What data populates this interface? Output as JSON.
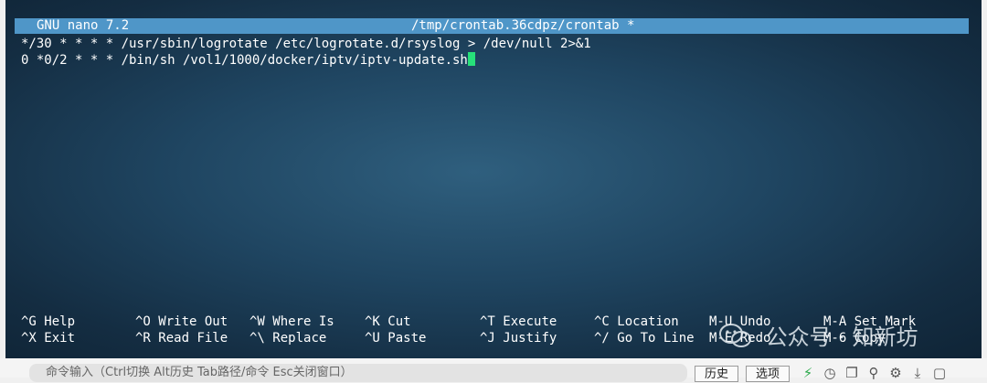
{
  "titlebar": {
    "app": "GNU nano 7.2",
    "file": "/tmp/crontab.36cdpz/crontab *"
  },
  "editor": {
    "lines": [
      "*/30 * * * * /usr/sbin/logrotate /etc/logrotate.d/rsyslog > /dev/null 2>&1",
      "0 *0/2 * * * /bin/sh /vol1/1000/docker/iptv/iptv-update.sh"
    ]
  },
  "shortcuts": [
    {
      "key": "^G",
      "label": "Help"
    },
    {
      "key": "^X",
      "label": "Exit"
    },
    {
      "key": "^O",
      "label": "Write Out"
    },
    {
      "key": "^R",
      "label": "Read File"
    },
    {
      "key": "^W",
      "label": "Where Is"
    },
    {
      "key": "^\\",
      "label": "Replace"
    },
    {
      "key": "^K",
      "label": "Cut"
    },
    {
      "key": "^U",
      "label": "Paste"
    },
    {
      "key": "^T",
      "label": "Execute"
    },
    {
      "key": "^J",
      "label": "Justify"
    },
    {
      "key": "^C",
      "label": "Location"
    },
    {
      "key": "^/",
      "label": "Go To Line"
    },
    {
      "key": "M-U",
      "label": "Undo"
    },
    {
      "key": "M-E",
      "label": "Redo"
    },
    {
      "key": "M-A",
      "label": "Set Mark"
    },
    {
      "key": "M-6",
      "label": "Copy"
    }
  ],
  "watermark": {
    "text": "公众号 · 知新坊",
    "icon": "wechat-icon"
  },
  "bottombar": {
    "command_placeholder": "命令输入（Ctrl切换 Alt历史 Tab路径/命令 Esc关闭窗口）",
    "history_button": "历史",
    "options_button": "选项"
  },
  "colors": {
    "titlebar_bg": "#4f96c8",
    "cursor": "#27e07a",
    "terminal_bg": "#1f4561"
  }
}
